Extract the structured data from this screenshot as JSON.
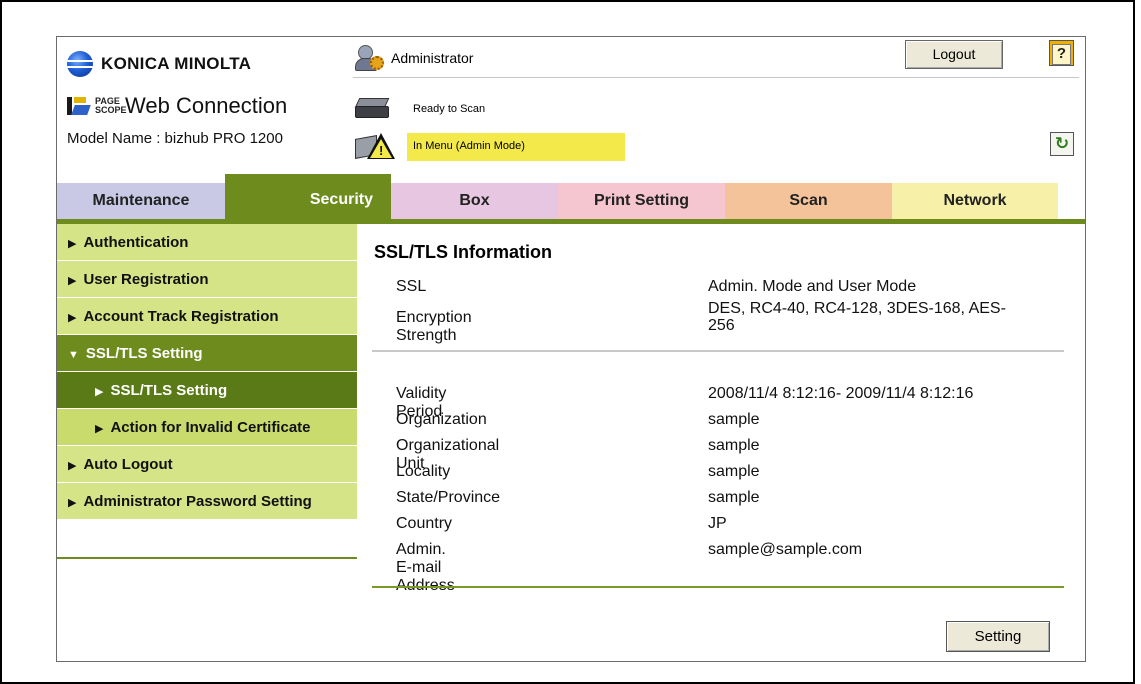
{
  "header": {
    "brand": "KONICA MINOLTA",
    "product_small": "PAGE SCOPE",
    "product_title": "Web Connection",
    "model_label": "Model Name : bizhub PRO 1200",
    "user_label": "Administrator",
    "logout_label": "Logout",
    "help_label": "?",
    "status_ready": "Ready to Scan",
    "status_mode": "In Menu (Admin Mode)",
    "status_mode_color": "#f3e94a"
  },
  "tabs": [
    {
      "label": "Maintenance",
      "color": "#c9c9e6"
    },
    {
      "label": "Security",
      "color": "#6e8c1e",
      "active": true
    },
    {
      "label": "Box",
      "color": "#e6c6e1"
    },
    {
      "label": "Print Setting",
      "color": "#f5c6cf"
    },
    {
      "label": "Scan",
      "color": "#f4c39a"
    },
    {
      "label": "Network",
      "color": "#f6f0a8"
    }
  ],
  "sidebar": {
    "items": [
      {
        "label": "Authentication"
      },
      {
        "label": "User Registration"
      },
      {
        "label": "Account Track Registration"
      },
      {
        "label": "SSL/TLS Setting"
      },
      {
        "label": "SSL/TLS Setting"
      },
      {
        "label": "Action for Invalid Certificate"
      },
      {
        "label": "Auto Logout"
      },
      {
        "label": "Administrator Password Setting"
      }
    ]
  },
  "main": {
    "title": "SSL/TLS Information",
    "summary": [
      {
        "label": "SSL",
        "value": "Admin. Mode and User Mode"
      },
      {
        "label": "Encryption Strength",
        "value": "DES, RC4-40, RC4-128, 3DES-168, AES-256"
      }
    ],
    "certificate": [
      {
        "label": "Validity Period",
        "value": "2008/11/4 8:12:16- 2009/11/4 8:12:16"
      },
      {
        "label": "Organization",
        "value": "sample"
      },
      {
        "label": "Organizational Unit",
        "value": "sample"
      },
      {
        "label": "Locality",
        "value": "sample"
      },
      {
        "label": "State/Province",
        "value": "sample"
      },
      {
        "label": "Country",
        "value": "JP"
      },
      {
        "label": "Admin. E-mail Address",
        "value": "sample@sample.com"
      }
    ],
    "setting_label": "Setting"
  }
}
